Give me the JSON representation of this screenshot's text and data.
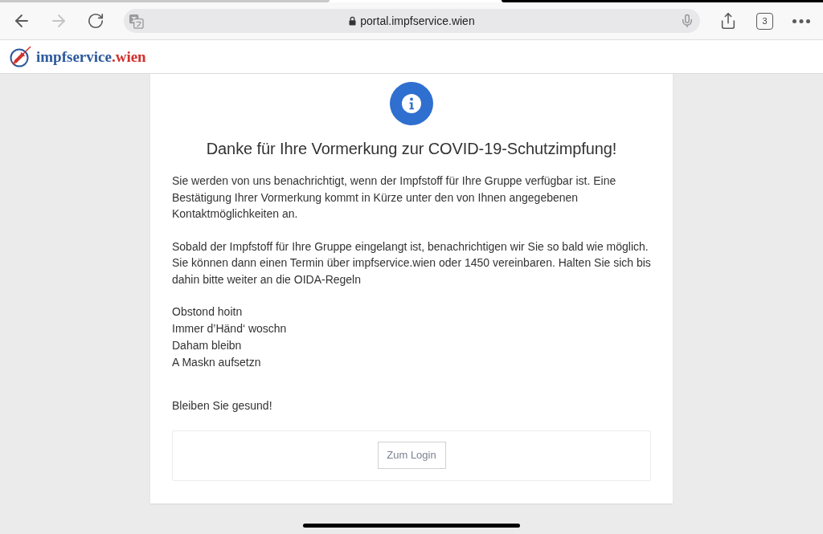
{
  "browser": {
    "nav_buttons": [
      {
        "kind": "back",
        "disabled": false
      },
      {
        "kind": "forward",
        "disabled": true
      },
      {
        "kind": "reload",
        "disabled": false
      }
    ],
    "url": "portal.impfservice.wien",
    "tab_count": "3"
  },
  "site_header": {
    "logo": {
      "name": "impfservice",
      "suffix": ".wien"
    }
  },
  "notice": {
    "title": "Danke für Ihre Vormerkung zur COVID-19-Schutzimpfung!",
    "paragraphs": [
      "Sie werden von uns benachrichtigt, wenn der Impfstoff für Ihre Gruppe verfügbar ist. Eine Bestätigung Ihrer Vormerkung kommt in Kürze unter den von Ihnen angegebenen Kontaktmöglichkeiten an.",
      "Sobald der Impfstoff für Ihre Gruppe eingelangt ist, benachrichtigen wir Sie so bald wie möglich. Sie können dann einen Termin über impfservice.wien oder 1450 vereinbaren. Halten Sie sich bis dahin bitte weiter an die OIDA-Regeln"
    ],
    "rules": [
      "Obstond hoitn",
      "Immer d’Händ‘ woschn",
      "Daham bleibn",
      "A Maskn aufsetzn"
    ],
    "closing": "Bleiben Sie gesund!",
    "button": "Zum Login"
  }
}
